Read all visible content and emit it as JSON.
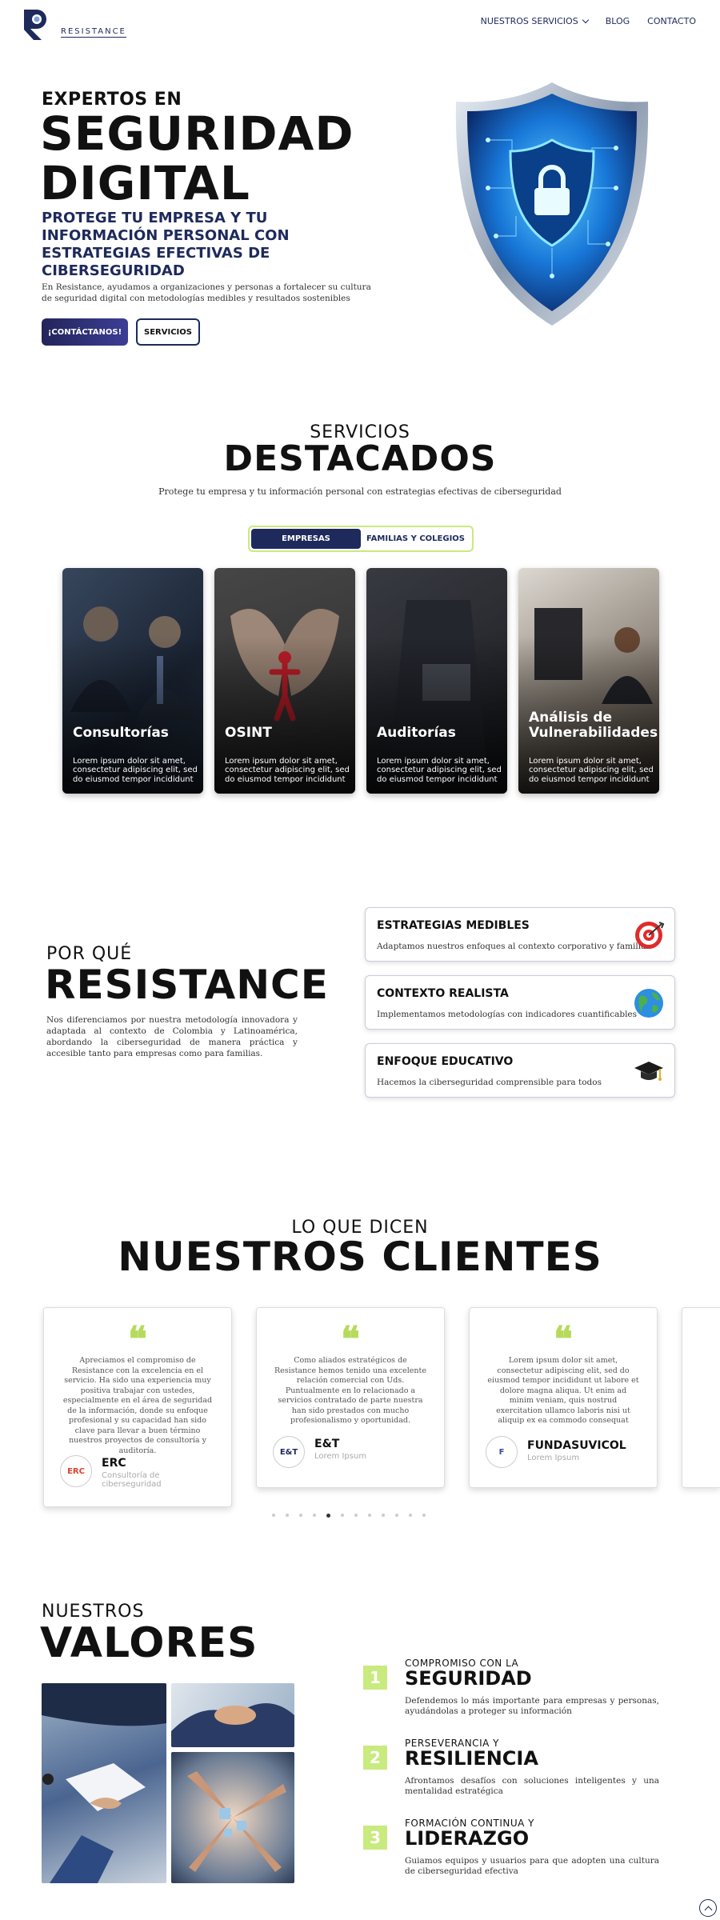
{
  "brand": {
    "name": "RESISTANCE",
    "accent": "#1e2a5c",
    "lime": "#c9ea7e"
  },
  "nav": {
    "services": "NUESTROS SERVICIOS",
    "blog": "BLOG",
    "contact": "CONTACTO"
  },
  "hero": {
    "kicker": "EXPERTOS EN",
    "title_line1": "SEGURIDAD",
    "title_line2": "DIGITAL",
    "subtitle": "PROTEGE TU EMPRESA Y TU INFORMACIÓN PERSONAL CON ESTRATEGIAS EFECTIVAS DE CIBERSEGURIDAD",
    "description": "En Resistance, ayudamos a organizaciones y personas a fortalecer su cultura de seguridad digital con metodologías medibles y resultados sostenibles",
    "cta_primary": "¡CONTÁCTANOS!",
    "cta_secondary": "SERVICIOS"
  },
  "services": {
    "kicker": "SERVICIOS",
    "title": "DESTACADOS",
    "description": "Protege tu empresa y tu información personal con estrategias efectivas de ciberseguridad",
    "tabs": [
      "EMPRESAS",
      "FAMILIAS Y COLEGIOS"
    ],
    "cards": [
      {
        "title": "Consultorías",
        "text": "Lorem ipsum dolor sit amet, consectetur adipiscing elit, sed do eiusmod tempor incididunt"
      },
      {
        "title": "OSINT",
        "text": "Lorem ipsum dolor sit amet, consectetur adipiscing elit, sed do eiusmod tempor incididunt"
      },
      {
        "title": "Auditorías",
        "text": "Lorem ipsum dolor sit amet, consectetur adipiscing elit, sed do eiusmod tempor incididunt"
      },
      {
        "title": "Análisis de Vulnerabilidades",
        "text": "Lorem ipsum dolor sit amet, consectetur adipiscing elit, sed do eiusmod tempor incididunt"
      }
    ]
  },
  "why": {
    "kicker": "POR QUÉ",
    "title": "RESISTANCE",
    "description": "Nos diferenciamos por nuestra metodología innovadora y adaptada al contexto de Colombia y Latinoamérica, abordando la ciberseguridad de manera práctica y accesible tanto para empresas como para familias.",
    "features": [
      {
        "title": "ESTRATEGIAS MEDIBLES",
        "text": "Adaptamos nuestros enfoques al contexto corporativo y familiar",
        "icon": "target-icon"
      },
      {
        "title": "CONTEXTO REALISTA",
        "text": "Implementamos metodologías con indicadores cuantificables",
        "icon": "globe-icon"
      },
      {
        "title": "ENFOQUE EDUCATIVO",
        "text": "Hacemos la ciberseguridad comprensible para todos",
        "icon": "graduation-cap-icon"
      }
    ]
  },
  "testimonials": {
    "kicker": "LO QUE DICEN",
    "title": "NUESTROS CLIENTES",
    "items": [
      {
        "text": "Apreciamos el compromiso de Resistance con la excelencia en el servicio. Ha sido una experiencia muy positiva trabajar con ustedes, especialmente en el área de seguridad de la información, donde su enfoque profesional y su capacidad han sido clave para llevar a buen término nuestros proyectos de consultoría y auditoría.",
        "name": "ERC",
        "role": "Consultoría de ciberseguridad",
        "logo": "ERC"
      },
      {
        "text": "Como aliados estratégicos de Resistance hemos tenido una excelente relación comercial con Uds. Puntualmente en lo relacionado a servicios contratado de parte nuestra han sido prestados con mucho profesionalismo y oportunidad.",
        "name": "E&T",
        "role": "Lorem Ipsum",
        "logo": "E&T"
      },
      {
        "text": "Lorem ipsum dolor sit amet, consectetur adipiscing elit, sed do eiusmod tempor incididunt ut labore et dolore magna aliqua. Ut enim ad minim veniam, quis nostrud exercitation ullamco laboris nisi ut aliquip ex ea commodo consequat",
        "name": "FUNDASUVICOL",
        "role": "Lorem Ipsum",
        "logo": "F"
      }
    ],
    "active_dot": 5,
    "dot_count": 12
  },
  "values": {
    "kicker": "NUESTROS",
    "title": "VALORES",
    "items": [
      {
        "num": "1",
        "kicker": "COMPROMISO CON LA",
        "title": "SEGURIDAD",
        "text": "Defendemos lo más importante para empresas y personas, ayudándolas a proteger su información"
      },
      {
        "num": "2",
        "kicker": "PERSEVERANCIA Y",
        "title": "RESILIENCIA",
        "text": "Afrontamos desafíos con soluciones inteligentes y una mentalidad estratégica"
      },
      {
        "num": "3",
        "kicker": "FORMACIÓN CONTINUA Y",
        "title": "LIDERAZGO",
        "text": "Guiamos equipos y usuarios para que adopten una cultura de ciberseguridad efectiva"
      }
    ]
  }
}
